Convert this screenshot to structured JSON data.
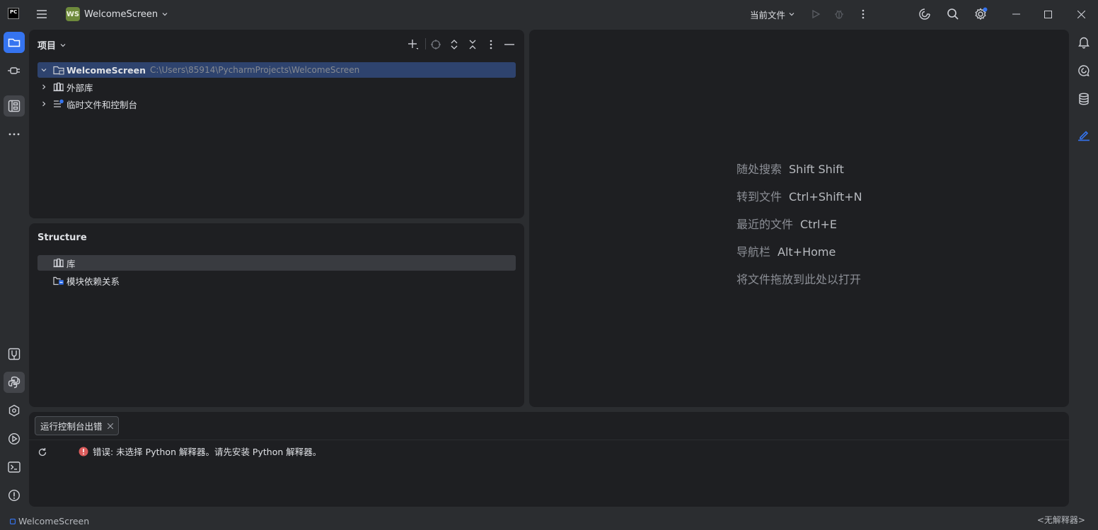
{
  "titlebar": {
    "app_logo": "PC",
    "project_badge": "WS",
    "project_name": "WelcomeScreen",
    "run_config": "当前文件",
    "icons": [
      "hamburger-menu-icon",
      "chevron-down-icon",
      "run-icon",
      "debug-icon",
      "more-vertical-icon",
      "ai-assistant-icon",
      "search-icon",
      "settings-icon",
      "minimize-icon",
      "maximize-icon",
      "close-icon"
    ],
    "settings_badge_color": "#3574f0"
  },
  "left_strip": {
    "top": [
      "folder-icon",
      "plugin-icon",
      "structure-icon",
      "more-horizontal-icon"
    ],
    "bottom": [
      "python-packages-icon",
      "python-console-icon",
      "services-icon",
      "run-icon",
      "terminal-icon",
      "problems-icon"
    ]
  },
  "right_strip": [
    "notifications-icon",
    "ai-chat-icon",
    "database-icon",
    "pen-icon"
  ],
  "project_panel": {
    "title": "项目",
    "tree": [
      {
        "label": "WelcomeScreen",
        "path": "C:\\Users\\85914\\PycharmProjects\\WelcomeScreen",
        "expanded": true,
        "selected": true
      },
      {
        "label": "外部库",
        "expanded": false
      },
      {
        "label": "临时文件和控制台",
        "expanded": false
      }
    ]
  },
  "structure_panel": {
    "title": "Structure",
    "items": [
      {
        "label": "库",
        "selected": true
      },
      {
        "label": "模块依赖关系"
      }
    ]
  },
  "editor": {
    "hints": [
      {
        "label": "随处搜索",
        "shortcut": "Shift Shift"
      },
      {
        "label": "转到文件",
        "shortcut": "Ctrl+Shift+N"
      },
      {
        "label": "最近的文件",
        "shortcut": "Ctrl+E"
      },
      {
        "label": "导航栏",
        "shortcut": "Alt+Home"
      },
      {
        "label": "将文件拖放到此处以打开",
        "shortcut": ""
      }
    ]
  },
  "run_panel": {
    "tab_label": "运行控制台出错",
    "error_message": "错误: 未选择 Python 解释器。请先安装 Python 解释器。",
    "error_color": "#db5c5c"
  },
  "statusbar": {
    "project": "WelcomeScreen",
    "interpreter": "<无解释器>"
  },
  "colors": {
    "accent": "#3574f0",
    "background": "#2b2d30",
    "panel": "#1e1f22"
  }
}
